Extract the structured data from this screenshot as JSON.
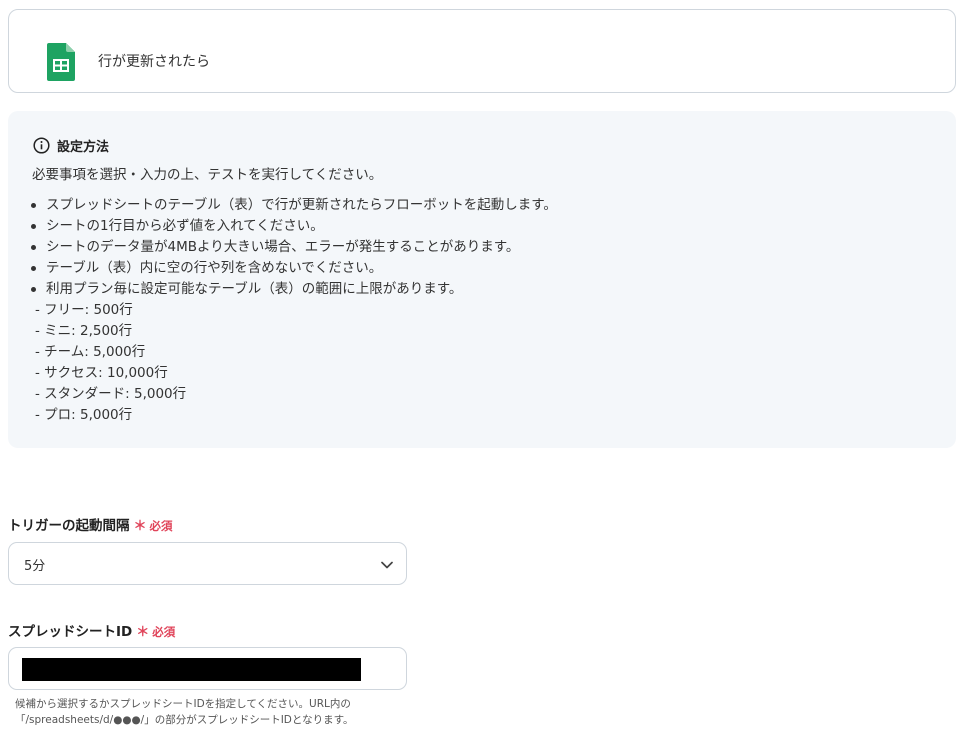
{
  "trigger": {
    "icon": "google-sheets-icon",
    "title": "行が更新されたら"
  },
  "info": {
    "icon": "info-circle-icon",
    "heading": "設定方法",
    "intro": "必要事項を選択・入力の上、テストを実行してください。",
    "bullets": [
      "スプレッドシートのテーブル（表）で行が更新されたらフローボットを起動します。",
      "シートの1行目から必ず値を入れてください。",
      "シートのデータ量が4MBより大きい場合、エラーが発生することがあります。",
      "テーブル（表）内に空の行や列を含めないでください。",
      "利用プラン毎に設定可能なテーブル（表）の範囲に上限があります。"
    ],
    "limits": [
      "- フリー: 500行",
      "- ミニ: 2,500行",
      "- チーム: 5,000行",
      "- サクセス: 10,000行",
      "- スタンダード: 5,000行",
      "- プロ: 5,000行"
    ]
  },
  "interval_field": {
    "label": "トリガーの起動間隔",
    "required_mark": "＊",
    "required_text": "必須",
    "value": "5分",
    "icon": "chevron-down-icon"
  },
  "sheet_id_field": {
    "label": "スプレッドシートID",
    "required_mark": "＊",
    "required_text": "必須",
    "help_line1": "候補から選択するかスプレッドシートIDを指定してください。URL内の",
    "help_line2": "「/spreadsheets/d/●●●/」の部分がスプレッドシートIDとなります。"
  },
  "colors": {
    "accent_required": "#e0445a",
    "sheets_green": "#1ea362",
    "info_bg": "#f4f7fa",
    "border": "#cfd6dd"
  }
}
